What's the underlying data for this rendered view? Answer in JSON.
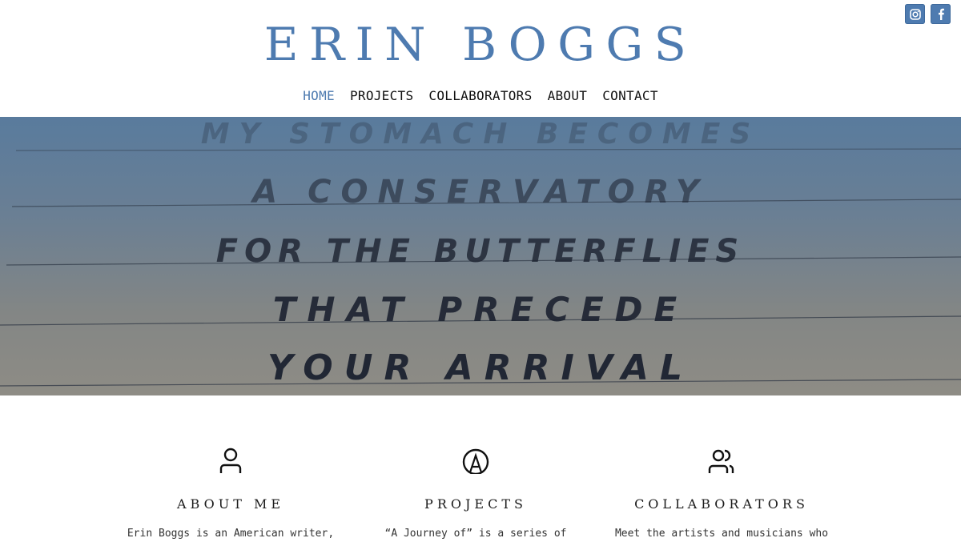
{
  "social": {
    "instagram_icon": "instagram-icon",
    "facebook_icon": "facebook-icon",
    "brand_color": "#4e7bb0"
  },
  "header": {
    "title": "ERIN BOGGS"
  },
  "nav": {
    "items": [
      {
        "label": "HOME",
        "active": true
      },
      {
        "label": "PROJECTS",
        "active": false
      },
      {
        "label": "COLLABORATORS",
        "active": false
      },
      {
        "label": "ABOUT",
        "active": false
      },
      {
        "label": "CONTACT",
        "active": false
      }
    ]
  },
  "hero": {
    "lines": [
      "MY STOMACH BECOMES",
      "A CONSERVATORY",
      "FOR THE BUTTERFLIES",
      "THAT PRECEDE",
      "YOUR ARRIVAL"
    ]
  },
  "features": [
    {
      "icon": "person-icon",
      "title": "ABOUT ME",
      "text": "Erin Boggs is an American writer,"
    },
    {
      "icon": "circled-a-icon",
      "title": "PROJECTS",
      "text": "“A Journey of” is a series of"
    },
    {
      "icon": "people-icon",
      "title": "COLLABORATORS",
      "text": "Meet the artists and musicians who"
    }
  ]
}
